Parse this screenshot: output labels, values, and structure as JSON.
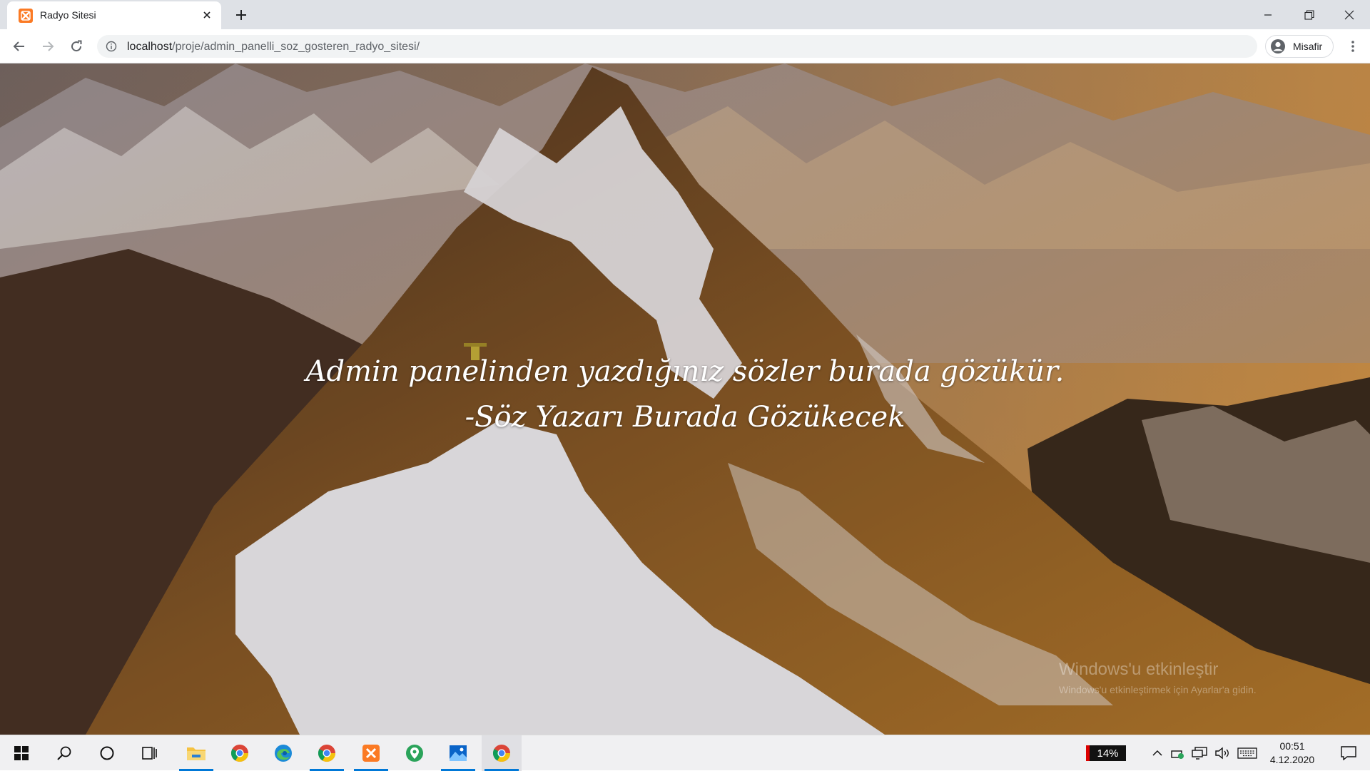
{
  "browser": {
    "tab": {
      "title": "Radyo Sitesi",
      "favicon": "xampp-icon"
    },
    "url": {
      "host": "localhost",
      "path": "/proje/admin_panelli_soz_gosteren_radyo_sitesi/"
    },
    "profile_label": "Misafir"
  },
  "page": {
    "quote_text": "Admin panelinden yazdığınız sözler burada gözükür.",
    "quote_author": "-Söz Yazarı Burada Gözükecek",
    "watermark": {
      "line1": "Windows'u etkinleştir",
      "line2": "Windows'u etkinleştirmek için Ayarlar'a gidin."
    },
    "background": "snowy mountain ridge at sunset photo"
  },
  "taskbar": {
    "apps": [
      "windows-start-icon",
      "search-icon",
      "cortana-icon",
      "task-view-icon",
      "file-explorer-icon",
      "chrome-icon",
      "edge-icon",
      "chrome-icon",
      "xampp-icon",
      "maps-icon",
      "photos-icon",
      "chrome-icon"
    ],
    "battery": "14%",
    "time": "00:51",
    "date": "4.12.2020"
  },
  "colors": {
    "accent": "#0078d7",
    "tab_bar": "#dee1e6",
    "xampp": "#fb7a24"
  }
}
